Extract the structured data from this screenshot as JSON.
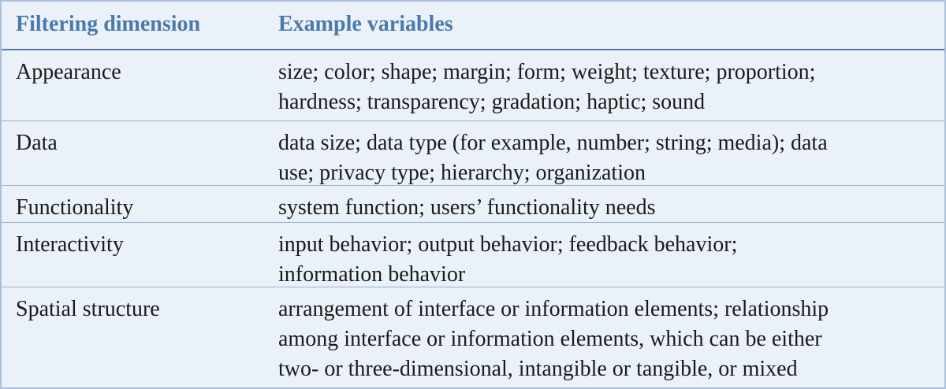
{
  "table": {
    "headers": [
      "Filtering dimension",
      "Example variables"
    ],
    "rows": [
      {
        "dimension": "Appearance",
        "lines": [
          "size; color; shape; margin; form; weight; texture; proportion;",
          "hardness; transparency; gradation; haptic; sound"
        ]
      },
      {
        "dimension": "Data",
        "lines": [
          "data size; data type (for example, number; string; media); data",
          "use; privacy type; hierarchy; organization"
        ]
      },
      {
        "dimension": "Functionality",
        "lines": [
          "system function; users’ functionality needs"
        ]
      },
      {
        "dimension": "Interactivity",
        "lines": [
          "input behavior; output behavior; feedback behavior;",
          "information behavior"
        ]
      },
      {
        "dimension": "Spatial structure",
        "lines": [
          "arrangement of interface or information elements; relationship",
          "among interface or information elements, which can be either",
          "two- or three-dimensional, intangible or tangible, or mixed"
        ]
      }
    ]
  },
  "colors": {
    "background": "#ebf1f9",
    "header_text": "#4a79ab",
    "header_rule": "#5a7aa6",
    "row_rule": "#9ab1cf",
    "border": "#a9c0dd"
  }
}
